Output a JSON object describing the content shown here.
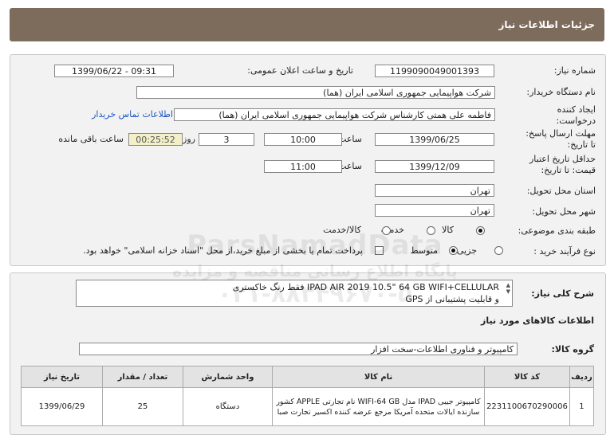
{
  "header": {
    "title": "جزئیات اطلاعات نیاز"
  },
  "form": {
    "need_number_label": "شماره نیاز:",
    "need_number": "1199090049001393",
    "announce_label": "تاریخ و ساعت اعلان عمومی:",
    "announce_value": "1399/06/22 - 09:31",
    "buyer_label": "نام دستگاه خریدار:",
    "buyer_value": "شرکت هواپیمایی جمهوری اسلامی ایران (هما)",
    "creator_label_1": "ایجاد کننده",
    "creator_label_2": "درخواست:",
    "creator_value": "فاطمه علی همتی کارشناس شرکت هواپیمایی جمهوری اسلامی ایران (هما)",
    "contact_link": "اطلاعات تماس خریدار",
    "deadline_label_1": "مهلت ارسال پاسخ:",
    "deadline_label_2": "تا تاریخ:",
    "deadline_date": "1399/06/25",
    "time_label": "ساعت",
    "deadline_time": "10:00",
    "days_value": "3",
    "days_label": "روز و",
    "remaining_time": "00:25:52",
    "remaining_label": "ساعت باقی مانده",
    "validity_label_1": "حداقل تاریخ اعتبار",
    "validity_label_2": "قیمت: تا تاریخ:",
    "validity_date": "1399/12/09",
    "validity_time": "11:00",
    "province_label": "استان محل تحویل:",
    "province_value": "تهران",
    "city_label": "شهر محل تحویل:",
    "city_value": "تهران",
    "category_label": "طبقه بندی موضوعی:",
    "category_options": [
      "کالا",
      "خدمت",
      "کالا/خدمت"
    ],
    "category_selected": "کالا",
    "process_label": "نوع فرآیند خرید :",
    "process_options": [
      "جزیی",
      "متوسط"
    ],
    "process_selected": "متوسط",
    "payment_note": "پرداخت تمام یا بخشی از مبلغ خرید،از محل \"اسناد خزانه اسلامی\" خواهد بود."
  },
  "description": {
    "label": "شرح کلی نیاز:",
    "line1": "IPAD AIR 2019 10.5\" 64 GB WIFI+CELLULAR فقط رنگ خاکستری",
    "line2": "و قابلیت پشتیبانی از GPS"
  },
  "goods": {
    "section_title": "اطلاعات کالاهای مورد نیاز",
    "group_label": "گروه کالا:",
    "group_value": "کامپیوتر و فناوری اطلاعات-سخت افزار",
    "columns": [
      "ردیف",
      "کد کالا",
      "نام کالا",
      "واحد شمارش",
      "تعداد / مقدار",
      "تاریخ نیاز"
    ],
    "rows": [
      {
        "index": "1",
        "code": "2231100670290006",
        "name": "کامپیوتر جیبی IPAD مدل WIFI-64 GB نام تجارتی APPLE کشور سازنده ایالات متحده آمریکا مرجع عرضه کننده اکسیر تجارت صبا",
        "unit": "دستگاه",
        "qty": "25",
        "date": "1399/06/29"
      }
    ]
  },
  "watermark": {
    "line1": "ParsNamadData",
    "line2": "پایگاه اطلاع رسانی مناقصه و مزایده",
    "line3": "۰۲۱-۸۸۳۴۹۶۷۰-۵"
  }
}
